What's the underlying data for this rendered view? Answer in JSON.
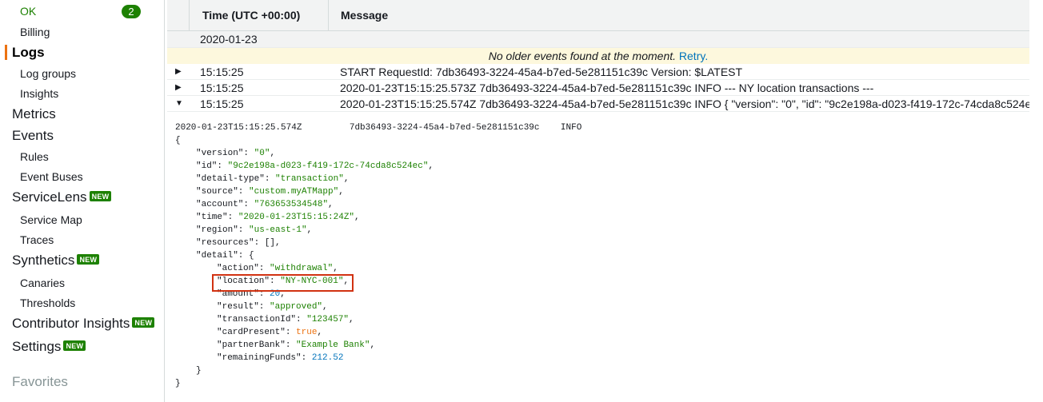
{
  "sidebar": {
    "ok_label": "OK",
    "ok_count": "2",
    "billing": "Billing",
    "logs": "Logs",
    "log_groups": "Log groups",
    "insights": "Insights",
    "metrics": "Metrics",
    "events": "Events",
    "rules": "Rules",
    "event_buses": "Event Buses",
    "servicelens": "ServiceLens",
    "service_map": "Service Map",
    "traces": "Traces",
    "synthetics": "Synthetics",
    "canaries": "Canaries",
    "thresholds": "Thresholds",
    "contributor_insights": "Contributor Insights",
    "settings": "Settings",
    "favorites": "Favorites",
    "new_badge": "NEW"
  },
  "table": {
    "col_time": "Time (UTC +00:00)",
    "col_message": "Message",
    "date": "2020-01-23",
    "notice": "No older events found at the moment.",
    "retry": "Retry."
  },
  "events": [
    {
      "time": "15:15:25",
      "message": "START RequestId: 7db36493-3224-45a4-b7ed-5e281151c39c Version: $LATEST"
    },
    {
      "time": "15:15:25",
      "message": "2020-01-23T15:15:25.573Z 7db36493-3224-45a4-b7ed-5e281151c39c INFO --- NY location transactions ---"
    },
    {
      "time": "15:15:25",
      "message": "2020-01-23T15:15:25.574Z 7db36493-3224-45a4-b7ed-5e281151c39c INFO { \"version\": \"0\", \"id\": \"9c2e198a-d023-f419-172c-74cda8c524e"
    }
  ],
  "detail": {
    "header_ts": "2020-01-23T15:15:25.574Z",
    "header_id": "7db36493-3224-45a4-b7ed-5e281151c39c",
    "header_level": "INFO",
    "open_brace": "{",
    "close_brace": "}",
    "version_key": "\"version\": ",
    "version_val": "\"0\"",
    "id_key": "\"id\": ",
    "id_val": "\"9c2e198a-d023-f419-172c-74cda8c524ec\"",
    "detail_type_key": "\"detail-type\": ",
    "detail_type_val": "\"transaction\"",
    "source_key": "\"source\": ",
    "source_val": "\"custom.myATMapp\"",
    "account_key": "\"account\": ",
    "account_val": "\"763653534548\"",
    "time_key": "\"time\": ",
    "time_val": "\"2020-01-23T15:15:24Z\"",
    "region_key": "\"region\": ",
    "region_val": "\"us-east-1\"",
    "resources_line": "\"resources\": [],",
    "detail_key": "\"detail\": {",
    "action_key": "\"action\": ",
    "action_val": "\"withdrawal\"",
    "location_key": "\"location\": ",
    "location_val": "\"NY-NYC-001\"",
    "amount_key": "\"amount\": ",
    "amount_val": "20",
    "result_key": "\"result\": ",
    "result_val": "\"approved\"",
    "transaction_key": "\"transactionId\": ",
    "transaction_val": "\"123457\"",
    "card_key": "\"cardPresent\": ",
    "card_val": "true",
    "partner_key": "\"partnerBank\": ",
    "partner_val": "\"Example Bank\"",
    "remaining_key": "\"remainingFunds\": ",
    "remaining_val": "212.52",
    "inner_close": "}",
    "comma": ","
  },
  "colors": {
    "accent": "#ec7211",
    "new_badge": "#1d8102",
    "link": "#0073bb",
    "highlight_box": "#d13212"
  }
}
